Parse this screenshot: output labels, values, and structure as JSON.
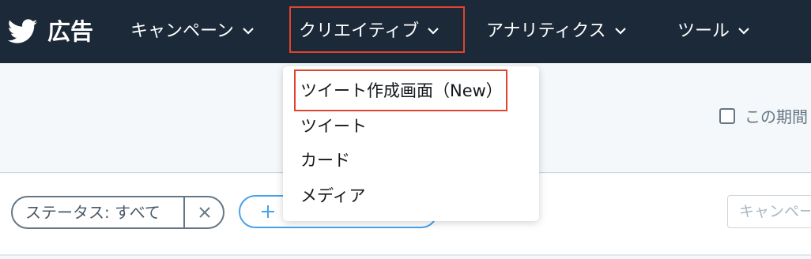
{
  "brand": {
    "name": "広告",
    "logo_icon": "twitter-bird-icon"
  },
  "nav": {
    "items": [
      {
        "label": "キャンペーン",
        "icon": "chevron-down-icon"
      },
      {
        "label": "クリエイティブ",
        "icon": "chevron-down-icon",
        "highlighted": true
      },
      {
        "label": "アナリティクス",
        "icon": "chevron-down-icon"
      },
      {
        "label": "ツール",
        "icon": "chevron-down-icon"
      }
    ]
  },
  "dropdown": {
    "items": [
      {
        "label": "ツイート作成画面（New）",
        "highlighted": true
      },
      {
        "label": "ツイート"
      },
      {
        "label": "カード"
      },
      {
        "label": "メディア"
      }
    ]
  },
  "period_checkbox": {
    "label": "この期間",
    "checked": false
  },
  "filters": {
    "status_chip": {
      "label": "ステータス: すべて",
      "icon": "close-icon"
    },
    "add_filter": {
      "icon": "plus-icon"
    }
  },
  "search": {
    "placeholder": "キャンペー"
  },
  "colors": {
    "nav_background": "#1c2938",
    "highlight_border": "#e0442c",
    "accent_blue": "#4aa1eb",
    "page_background": "#f5f8fa"
  }
}
